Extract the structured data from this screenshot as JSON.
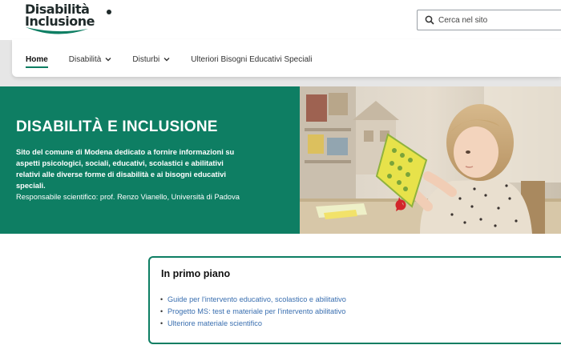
{
  "logo": {
    "line1": "Disabilità",
    "line2": "Inclusione",
    "brand_color": "#0e7e63"
  },
  "search": {
    "placeholder": "Cerca nel sito",
    "icon": "search-icon"
  },
  "nav": {
    "items": [
      {
        "label": "Home",
        "active": true,
        "dropdown": false
      },
      {
        "label": "Disabilità",
        "active": false,
        "dropdown": true
      },
      {
        "label": "Disturbi",
        "active": false,
        "dropdown": true
      },
      {
        "label": "Ulteriori Bisogni Educativi Speciali",
        "active": false,
        "dropdown": false
      }
    ]
  },
  "hero": {
    "title": "DISABILITÀ E INCLUSIONE",
    "description": "Sito del comune di Modena dedicato a fornire informazioni su aspetti psicologici, sociali, educativi, scolastici e abilitativi relativi alle diverse forme di disabilità e ai bisogni educativi speciali.",
    "responsible": "Responsabile scientifico: prof. Renzo Vianello, Università di Padova",
    "background_color": "#0e7e63"
  },
  "featured": {
    "title": "In primo piano",
    "links": [
      "Guide per l'intervento educativo, scolastico e abilitativo",
      "Progetto MS: test e materiale per l'intervento abilitativo",
      "Ulteriore materiale scientifico"
    ],
    "link_color": "#3a6fb0"
  }
}
